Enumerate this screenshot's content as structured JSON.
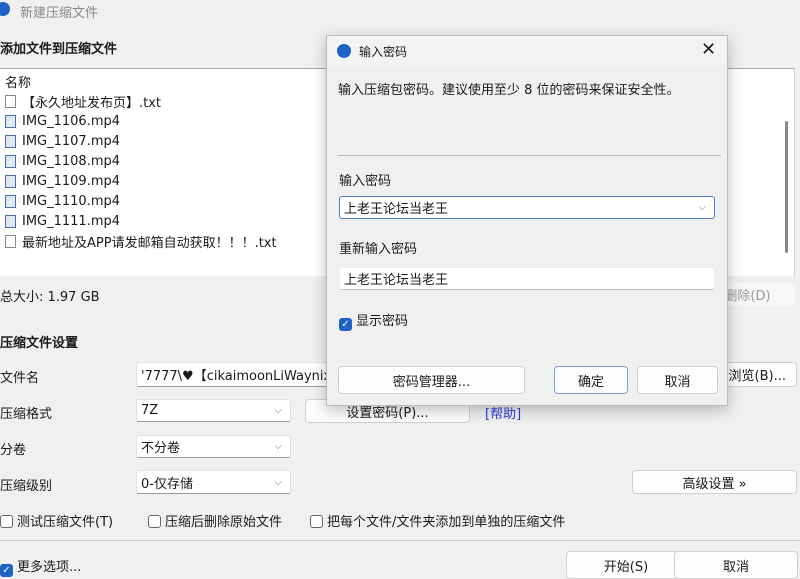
{
  "window": {
    "title": "新建压缩文件",
    "add_heading": "添加文件到压缩文件"
  },
  "file_list": {
    "header": "名称",
    "items": [
      {
        "name": "【永久地址发布页】.txt",
        "type": "txt"
      },
      {
        "name": "IMG_1106.mp4",
        "type": "video"
      },
      {
        "name": "IMG_1107.mp4",
        "type": "video"
      },
      {
        "name": "IMG_1108.mp4",
        "type": "video"
      },
      {
        "name": "IMG_1109.mp4",
        "type": "video"
      },
      {
        "name": "IMG_1110.mp4",
        "type": "video"
      },
      {
        "name": "IMG_1111.mp4",
        "type": "video"
      },
      {
        "name": "最新地址及APP请发邮箱自动获取！！！.txt",
        "type": "txt"
      }
    ]
  },
  "total_size": "总大小: 1.97 GB",
  "delete_label": "删除(D)",
  "settings": {
    "heading": "压缩文件设置",
    "filename_label": "文件名",
    "filename_value": "'7777\\♥【cikaimoonLiWaynix",
    "browse_label": "浏览(B)...",
    "format_label": "压缩格式",
    "format_value": "7Z",
    "set_password_label": "设置密码(P)...",
    "help_label": "[帮助]",
    "split_label": "分卷",
    "split_value": "不分卷",
    "level_label": "压缩级别",
    "level_value": "0-仅存储",
    "advanced_label": "高级设置 »",
    "test_label": "测试压缩文件(T)",
    "delete_after_label": "压缩后删除原始文件",
    "separate_label": "把每个文件/文件夹添加到单独的压缩文件",
    "more_options_label": "更多选项...",
    "start_label": "开始(S)",
    "cancel_label": "取消"
  },
  "dialog": {
    "title": "输入密码",
    "description": "输入压缩包密码。建议使用至少 8 位的密码来保证安全性。",
    "password_label": "输入密码",
    "password_value": "上老王论坛当老王",
    "reenter_label": "重新输入密码",
    "reenter_value": "上老王论坛当老王",
    "show_password_label": "显示密码",
    "manager_label": "密码管理器...",
    "ok_label": "确定",
    "cancel_label": "取消"
  },
  "colors": {
    "accent": "#1e63c4",
    "help_link": "#2a3fd6"
  }
}
